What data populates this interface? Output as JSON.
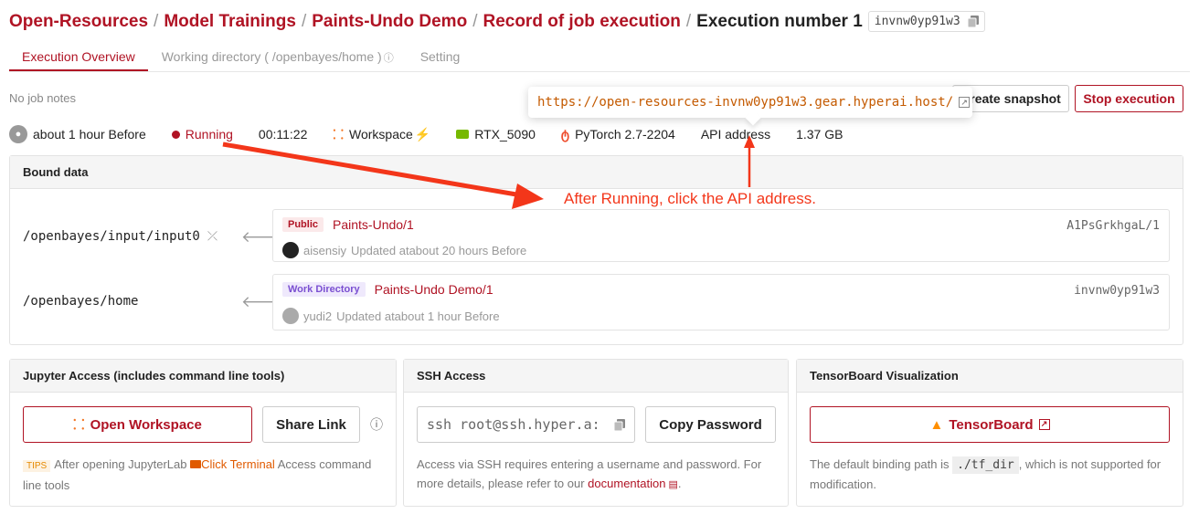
{
  "breadcrumb": {
    "items": [
      "Open-Resources",
      "Model Trainings",
      "Paints-Undo Demo",
      "Record of job execution"
    ],
    "current": "Execution number 1",
    "job_id": "invnw0yp91w3"
  },
  "tabs": [
    "Execution Overview",
    "Working directory ( /openbayes/home )",
    "Setting"
  ],
  "notes": "No job notes",
  "buttons": {
    "snapshot": "Create snapshot",
    "stop": "Stop execution"
  },
  "tooltip": {
    "url": "https://open-resources-invnw0yp91w3.gear.hyperai.host/"
  },
  "status": {
    "time": "about 1 hour Before",
    "state": "Running",
    "duration": "00:11:22",
    "env": "Workspace",
    "gpu": "RTX_5090",
    "framework": "PyTorch 2.7-2204",
    "api": "API address",
    "size": "1.37 GB"
  },
  "bound": {
    "title": "Bound data",
    "items": [
      {
        "path": "/openbayes/input/input0",
        "badge": "Public",
        "name": "Paints-Undo/1",
        "version": "A1PsGrkhgaL/1",
        "user": "aisensiy",
        "updated": "Updated atabout 20 hours Before"
      },
      {
        "path": "/openbayes/home",
        "badge": "Work Directory",
        "name": "Paints-Undo Demo/1",
        "version": "invnw0yp91w3",
        "user": "yudi2",
        "updated": "Updated atabout 1 hour Before"
      }
    ]
  },
  "jupyter": {
    "title": "Jupyter Access (includes command line tools)",
    "open": "Open Workspace",
    "share": "Share Link",
    "tips": "TIPS",
    "note_a": "After opening JupyterLab",
    "note_link": "Click Terminal",
    "note_b": "Access command line tools"
  },
  "ssh": {
    "title": "SSH Access",
    "command": "ssh root@ssh.hyper.a:",
    "copy": "Copy Password",
    "note_a": "Access via SSH requires entering a username and password. For more details, please refer to our",
    "note_link": "documentation",
    "note_b": "."
  },
  "tensorboard": {
    "title": "TensorBoard Visualization",
    "btn": "TensorBoard",
    "note_a": "The default binding path is",
    "path": "./tf_dir",
    "note_b": ", which is not supported for modification."
  },
  "annotation": "After Running, click the API address.",
  "colors": {
    "brand": "#b01324",
    "annotation": "#f3361a"
  }
}
